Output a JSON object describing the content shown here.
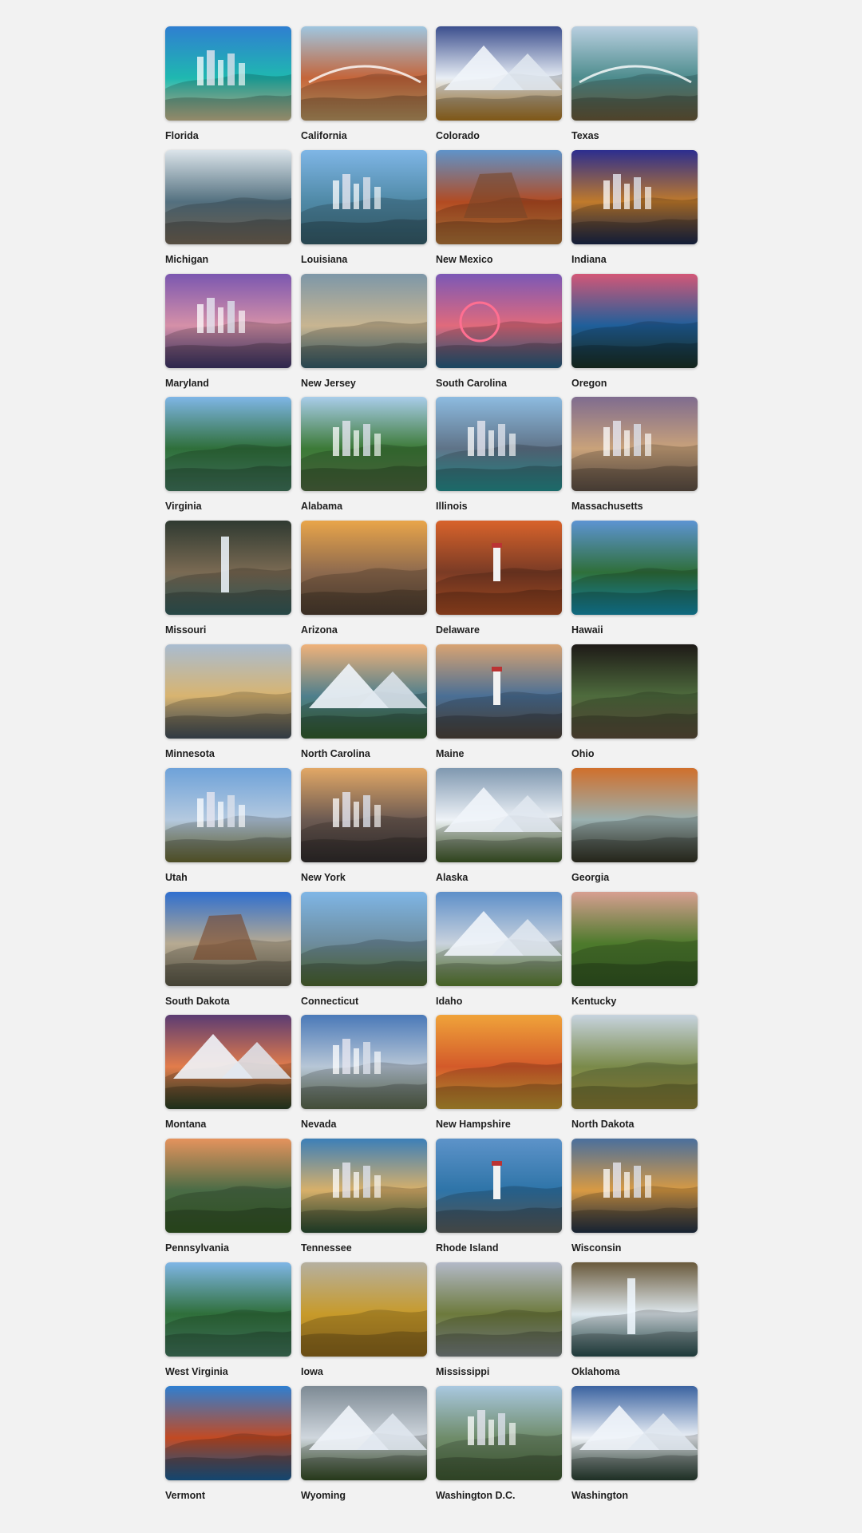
{
  "gallery": {
    "states": [
      {
        "name": "Florida",
        "scene": "coast-city",
        "colors": {
          "sky": "#2f7fd1",
          "mid": "#1fb8b0",
          "ground": "#e9d9a6"
        }
      },
      {
        "name": "California",
        "scene": "beach-bridge",
        "colors": {
          "sky": "#9fc6e0",
          "mid": "#c4653a",
          "ground": "#d9b072"
        }
      },
      {
        "name": "Colorado",
        "scene": "snow-mountains",
        "colors": {
          "sky": "#3c4f8e",
          "mid": "#e8eef5",
          "ground": "#c88a25"
        }
      },
      {
        "name": "Texas",
        "scene": "river-bridge",
        "colors": {
          "sky": "#b9cfe0",
          "mid": "#4d8c8d",
          "ground": "#7d6a43"
        }
      },
      {
        "name": "Michigan",
        "scene": "cliff-lake",
        "colors": {
          "sky": "#dbe4ea",
          "mid": "#53707f",
          "ground": "#8a7a67"
        }
      },
      {
        "name": "Louisiana",
        "scene": "city-river",
        "colors": {
          "sky": "#7fb6e6",
          "mid": "#4f89a6",
          "ground": "#3f6e7d"
        }
      },
      {
        "name": "New Mexico",
        "scene": "desert-rock",
        "colors": {
          "sky": "#5f93c9",
          "mid": "#b24b22",
          "ground": "#d08b43"
        }
      },
      {
        "name": "Indiana",
        "scene": "night-city",
        "colors": {
          "sky": "#2c2e8f",
          "mid": "#c07a2b",
          "ground": "#1e2e58"
        }
      },
      {
        "name": "Maryland",
        "scene": "city-reflection",
        "colors": {
          "sky": "#7b57b0",
          "mid": "#d590a8",
          "ground": "#4a3f7a"
        }
      },
      {
        "name": "New Jersey",
        "scene": "clouds-beach",
        "colors": {
          "sky": "#7d97a8",
          "mid": "#c8b591",
          "ground": "#3f6e7d"
        }
      },
      {
        "name": "South Carolina",
        "scene": "ferris-wheel",
        "colors": {
          "sky": "#7b58b6",
          "mid": "#e06a7c",
          "ground": "#2b6f9a"
        }
      },
      {
        "name": "Oregon",
        "scene": "crater-lake",
        "colors": {
          "sky": "#d35777",
          "mid": "#1f5f9a",
          "ground": "#1f3a2c"
        }
      },
      {
        "name": "Virginia",
        "scene": "river-valley",
        "colors": {
          "sky": "#7fb6e6",
          "mid": "#2f6f3a",
          "ground": "#4d8c6d"
        }
      },
      {
        "name": "Alabama",
        "scene": "city-lake",
        "colors": {
          "sky": "#a9cdea",
          "mid": "#3c7a37",
          "ground": "#5a7c4a"
        }
      },
      {
        "name": "Illinois",
        "scene": "skyline-water",
        "colors": {
          "sky": "#8dbbe0",
          "mid": "#5f7388",
          "ground": "#2da7a6"
        }
      },
      {
        "name": "Massachusetts",
        "scene": "harbor-dusk",
        "colors": {
          "sky": "#7f6c8f",
          "mid": "#c9a27a",
          "ground": "#6d5d51"
        }
      },
      {
        "name": "Missouri",
        "scene": "waterfall-cave",
        "colors": {
          "sky": "#2f3a31",
          "mid": "#7a6a53",
          "ground": "#3e6f6e"
        }
      },
      {
        "name": "Arizona",
        "scene": "canyon-sunset",
        "colors": {
          "sky": "#e9a54a",
          "mid": "#8e6a4e",
          "ground": "#5c4a39"
        }
      },
      {
        "name": "Delaware",
        "scene": "lighthouse-sunset",
        "colors": {
          "sky": "#d8632b",
          "mid": "#7a3b25",
          "ground": "#c95b2a"
        }
      },
      {
        "name": "Hawaii",
        "scene": "island-coast",
        "colors": {
          "sky": "#5d94d2",
          "mid": "#2f6f3a",
          "ground": "#1aa5c8"
        }
      },
      {
        "name": "Minnesota",
        "scene": "lake-sunset",
        "colors": {
          "sky": "#a9bcd1",
          "mid": "#d8b470",
          "ground": "#4d5c69"
        }
      },
      {
        "name": "North Carolina",
        "scene": "mountain-overlook",
        "colors": {
          "sky": "#f0b27a",
          "mid": "#4f7f8c",
          "ground": "#3b6f34"
        }
      },
      {
        "name": "Maine",
        "scene": "lighthouse-coast",
        "colors": {
          "sky": "#d8a372",
          "mid": "#4a6f95",
          "ground": "#5c5045"
        }
      },
      {
        "name": "Ohio",
        "scene": "forest-arch",
        "colors": {
          "sky": "#1e1a17",
          "mid": "#4e6b3d",
          "ground": "#6b5b45"
        }
      },
      {
        "name": "Utah",
        "scene": "valley-city",
        "colors": {
          "sky": "#6ea2d9",
          "mid": "#b4c9df",
          "ground": "#7a7a3a"
        }
      },
      {
        "name": "New York",
        "scene": "statue-skyline",
        "colors": {
          "sky": "#e2a866",
          "mid": "#6c5a52",
          "ground": "#3a3535"
        }
      },
      {
        "name": "Alaska",
        "scene": "snow-peak",
        "colors": {
          "sky": "#7f98b0",
          "mid": "#eef2f7",
          "ground": "#4b6b2e"
        }
      },
      {
        "name": "Georgia",
        "scene": "sunset-lakes",
        "colors": {
          "sky": "#d06f2c",
          "mid": "#9ab0b0",
          "ground": "#3b3b2a"
        }
      },
      {
        "name": "South Dakota",
        "scene": "mount-rushmore",
        "colors": {
          "sky": "#2f6fcf",
          "mid": "#b7aa92",
          "ground": "#6d6a55"
        }
      },
      {
        "name": "Connecticut",
        "scene": "town-reflection",
        "colors": {
          "sky": "#7fb6e6",
          "mid": "#6d8c9d",
          "ground": "#5d7c3a"
        }
      },
      {
        "name": "Idaho",
        "scene": "mountain-valley",
        "colors": {
          "sky": "#5d8fc9",
          "mid": "#c9d2dd",
          "ground": "#6e9a3a"
        }
      },
      {
        "name": "Kentucky",
        "scene": "barn-field",
        "colors": {
          "sky": "#d79f91",
          "mid": "#4d7a2c",
          "ground": "#3d6a2a"
        }
      },
      {
        "name": "Montana",
        "scene": "mountain-lake-sunset",
        "colors": {
          "sky": "#5b3b73",
          "mid": "#e27c4b",
          "ground": "#2f4a2a"
        }
      },
      {
        "name": "Nevada",
        "scene": "palms-city",
        "colors": {
          "sky": "#4a79b8",
          "mid": "#b7c6d6",
          "ground": "#6a7a5a"
        }
      },
      {
        "name": "New Hampshire",
        "scene": "village-reflection",
        "colors": {
          "sky": "#f0a33a",
          "mid": "#d35a2a",
          "ground": "#e2b13a"
        }
      },
      {
        "name": "North Dakota",
        "scene": "badlands",
        "colors": {
          "sky": "#c7d4df",
          "mid": "#7a8a4a",
          "ground": "#a2953d"
        }
      },
      {
        "name": "Pennsylvania",
        "scene": "sunrise-hills",
        "colors": {
          "sky": "#e5935d",
          "mid": "#4a6c46",
          "ground": "#3d6a2a"
        }
      },
      {
        "name": "Tennessee",
        "scene": "city-aerial",
        "colors": {
          "sky": "#3c7fb8",
          "mid": "#d8b06a",
          "ground": "#2f5a3a"
        }
      },
      {
        "name": "Rhode Island",
        "scene": "lighthouse-rocks",
        "colors": {
          "sky": "#5d93c9",
          "mid": "#2e74a8",
          "ground": "#6a6f6d"
        }
      },
      {
        "name": "Wisconsin",
        "scene": "harbor-night",
        "colors": {
          "sky": "#4a6f9d",
          "mid": "#d89a43",
          "ground": "#253851"
        }
      },
      {
        "name": "West Virginia",
        "scene": "river-valley",
        "colors": {
          "sky": "#7fb6e6",
          "mid": "#2f6f3a",
          "ground": "#4d8c6d"
        }
      },
      {
        "name": "Iowa",
        "scene": "fields",
        "colors": {
          "sky": "#b5b0a0",
          "mid": "#c79a2a",
          "ground": "#a77a22"
        }
      },
      {
        "name": "Mississippi",
        "scene": "river-wide",
        "colors": {
          "sky": "#b3b9c8",
          "mid": "#6d7a3c",
          "ground": "#8f9a99"
        }
      },
      {
        "name": "Oklahoma",
        "scene": "waterfall-forest",
        "colors": {
          "sky": "#6a5a3c",
          "mid": "#dfe9ef",
          "ground": "#2f5a5a"
        }
      },
      {
        "name": "Vermont",
        "scene": "autumn-lake",
        "colors": {
          "sky": "#2f7fd1",
          "mid": "#c24a23",
          "ground": "#1f6fb0"
        }
      },
      {
        "name": "Wyoming",
        "scene": "mountain-reflection",
        "colors": {
          "sky": "#7d8a94",
          "mid": "#cfd6dd",
          "ground": "#3d5a2a"
        }
      },
      {
        "name": "Washington D.C.",
        "scene": "capitol-aerial",
        "colors": {
          "sky": "#a9c8e0",
          "mid": "#6f8c6a",
          "ground": "#4a6a3a"
        }
      },
      {
        "name": "Washington",
        "scene": "mount-rainier",
        "colors": {
          "sky": "#3b63a0",
          "mid": "#eef2f7",
          "ground": "#2f4a3a"
        }
      }
    ]
  }
}
